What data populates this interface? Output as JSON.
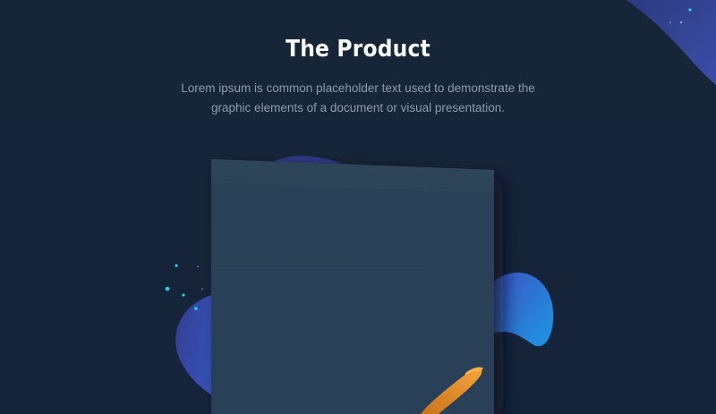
{
  "section": {
    "title": "The Product",
    "description": "Lorem ipsum is common placeholder text used to demonstrate the graphic elements of a document or visual presentation."
  },
  "colors": {
    "background": "#16253a",
    "title": "#ffffff",
    "description": "#8e9aad",
    "card": "#2b3f56",
    "blob_start": "#3a46a0",
    "blob_end": "#1e9be6",
    "accent_orange": "#f0911f",
    "accent_cyan": "#22d3ee"
  }
}
